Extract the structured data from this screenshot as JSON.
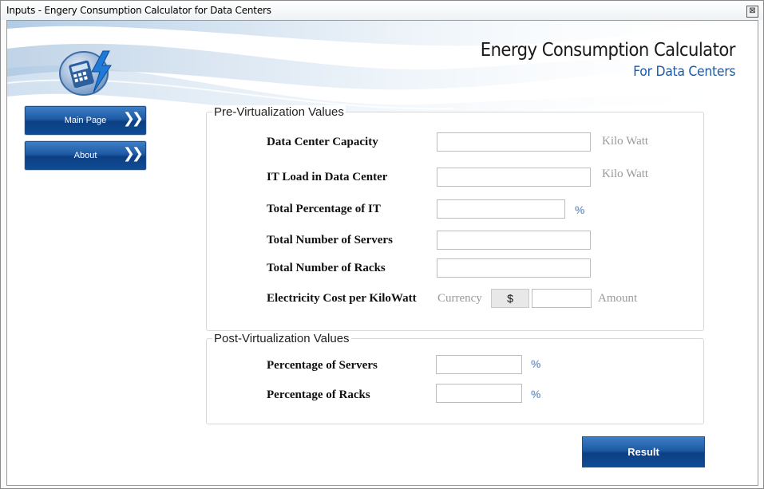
{
  "window": {
    "title": "Inputs - Engery Consumption Calculator for Data Centers",
    "close_glyph": "⊠"
  },
  "header": {
    "title": "Energy Consumption Calculator",
    "subtitle": "For Data Centers"
  },
  "nav": [
    {
      "label": "Main Page",
      "chevron": "❯❯"
    },
    {
      "label": "About",
      "chevron": "❯❯"
    }
  ],
  "pre": {
    "title": "Pre-Virtualization Values",
    "fields": [
      {
        "label": "Data Center Capacity",
        "value": "",
        "unit": "Kilo Watt"
      },
      {
        "label": "IT Load in Data Center",
        "value": "",
        "unit": "Kilo Watt"
      },
      {
        "label": "Total Percentage of IT",
        "value": "",
        "unit": "%"
      },
      {
        "label": "Total Number of Servers",
        "value": ""
      },
      {
        "label": "Total Number of Racks",
        "value": ""
      }
    ],
    "electricity": {
      "label": "Electricity Cost per KiloWatt",
      "currency_label": "Currency",
      "currency_symbol": "$",
      "value": "",
      "amount_label": "Amount"
    }
  },
  "post": {
    "title": "Post-Virtualization Values",
    "fields": [
      {
        "label": "Percentage of Servers",
        "value": "",
        "unit": "%"
      },
      {
        "label": "Percentage of Racks",
        "value": "",
        "unit": "%"
      }
    ]
  },
  "result_label": "Result",
  "colors": {
    "accent": "#1d5aa3",
    "subtitle": "#1e5aa7",
    "unit_gray": "#9a9a9a",
    "percent": "#7d9ec7"
  }
}
